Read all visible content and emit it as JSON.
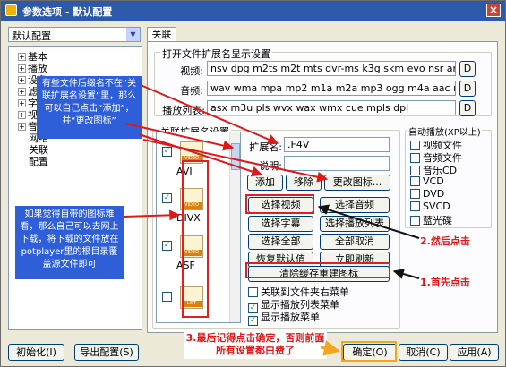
{
  "window": {
    "title": "参数选项 - 默认配置",
    "close_glyph": "×"
  },
  "profile": {
    "value": "默认配置"
  },
  "tree": {
    "items": [
      {
        "label": "基本",
        "expand": "+"
      },
      {
        "label": "播放",
        "expand": "+"
      },
      {
        "label": "设备",
        "expand": "+"
      },
      {
        "label": "滤镜",
        "expand": "+"
      },
      {
        "label": "字幕",
        "expand": "+"
      },
      {
        "label": "视频",
        "expand": "+"
      },
      {
        "label": "音频",
        "expand": "+"
      },
      {
        "label": "网络",
        "expand": ""
      },
      {
        "label": "关联",
        "expand": ""
      },
      {
        "label": "配置",
        "expand": ""
      }
    ]
  },
  "tab": {
    "label": "关联"
  },
  "ext_group": {
    "title": "打开文件扩展名显示设置",
    "rows": [
      {
        "label": "视频:",
        "value": "nsv dpg m2ts m2t mts dvr-ms k3g skm evo nsr amv divx webm",
        "btn": "D"
      },
      {
        "label": "音频:",
        "value": "wav wma mpa mp2 m1a m2a mp3 ogg m4a aac mka ra flac ape",
        "btn": "D"
      },
      {
        "label": "播放列表:",
        "value": "asx m3u pls wvx wax wmx cue mpls dpl",
        "btn": "D"
      }
    ]
  },
  "assoc": {
    "title": "关联扩展名设置",
    "items": [
      {
        "label": "AVI",
        "tag": "VIDEO",
        "checked": "✓"
      },
      {
        "label": "DIVX",
        "tag": "VIDEO",
        "checked": "✓"
      },
      {
        "label": "ASF",
        "tag": "VIDEO",
        "checked": "✓"
      },
      {
        "label": "",
        "tag": "LIST",
        "checked": ""
      }
    ],
    "ext_label": "扩展名:",
    "ext_value": ".F4V",
    "desc_label": "说明:",
    "desc_value": "",
    "add": "添加",
    "remove": "移除",
    "change_icon": "更改图标...",
    "select_video": "选择视频",
    "select_audio": "选择音频",
    "select_subs": "选择字幕",
    "select_playlist": "选择播放列表",
    "select_all": "选择全部",
    "deselect_all": "全部取消",
    "restore_default": "恢复默认值",
    "refresh_now": "立即刷新",
    "clear_cache": "清除缓存重建图标",
    "options": [
      {
        "label": "关联到文件夹右菜单",
        "checked": ""
      },
      {
        "label": "显示播放列表菜单",
        "checked": "✓"
      },
      {
        "label": "显示播放菜单",
        "checked": "✓"
      }
    ]
  },
  "autoplay": {
    "title": "自动播放(XP以上)",
    "items": [
      {
        "label": "视频文件",
        "checked": ""
      },
      {
        "label": "音频文件",
        "checked": ""
      },
      {
        "label": "音乐CD",
        "checked": ""
      },
      {
        "label": "VCD",
        "checked": ""
      },
      {
        "label": "DVD",
        "checked": ""
      },
      {
        "label": "SVCD",
        "checked": ""
      },
      {
        "label": "蓝光碟",
        "checked": ""
      }
    ]
  },
  "footer": {
    "init": "初始化(I)",
    "export": "导出配置(S)",
    "ok": "确定(O)",
    "cancel": "取消(C)",
    "apply": "应用(A)"
  },
  "annotations": {
    "top_note": "有些文件后缀名不在“关联扩展名设置”里，那么可以自己点击“添加”，并“更改图标”",
    "left_note": "如果觉得自带的图标难看，那么自己可以去网上下载，将下载的文件放在potplayer里的根目录覆盖源文件即可",
    "step1": "1.首先点击",
    "step2": "2.然后点击",
    "step3": "3.最后记得点击确定，否则前面所有设置都白费了"
  },
  "colors": {
    "annotation_red": "#e01818",
    "note_blue": "#2e5fd8",
    "titlebar": "#2c5aa8"
  }
}
